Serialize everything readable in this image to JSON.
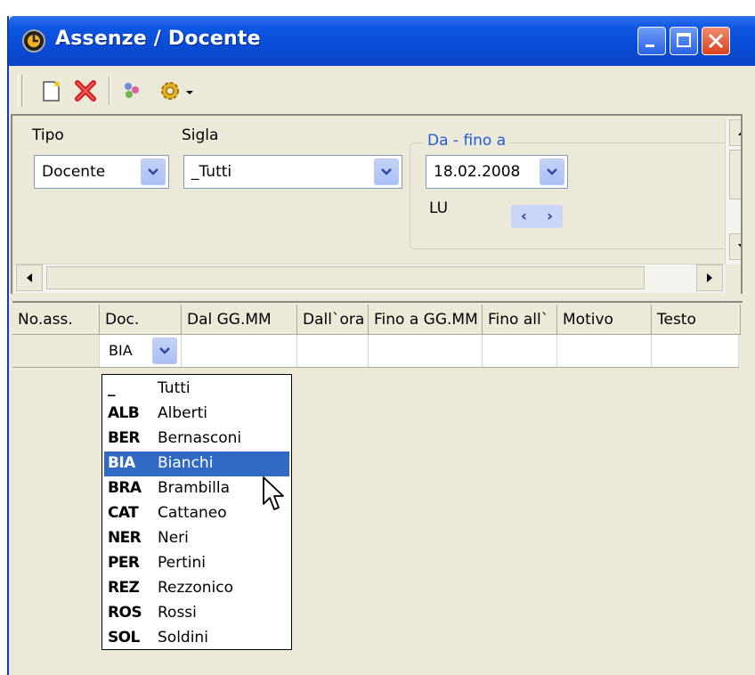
{
  "window": {
    "title": "Assenze / Docente"
  },
  "filters": {
    "tipo_label": "Tipo",
    "tipo_value": "Docente",
    "sigla_label": "Sigla",
    "sigla_value": "_Tutti",
    "group_title": "Da - fino a",
    "date_value": "18.02.2008",
    "day_label": "LU",
    "nav_prev": "‹",
    "nav_next": "›"
  },
  "table": {
    "columns": [
      "No.ass.",
      "Doc.",
      "Dal GG.MM",
      "Dall`ora",
      "Fino a GG.MM",
      "Fino all`",
      "Motivo",
      "Testo"
    ],
    "row_doc_value": "BIA"
  },
  "dropdown": {
    "items": [
      {
        "code": "_",
        "name": "Tutti"
      },
      {
        "code": "ALB",
        "name": "Alberti"
      },
      {
        "code": "BER",
        "name": "Bernasconi"
      },
      {
        "code": "BIA",
        "name": "Bianchi"
      },
      {
        "code": "BRA",
        "name": "Brambilla"
      },
      {
        "code": "CAT",
        "name": "Cattaneo"
      },
      {
        "code": "NER",
        "name": "Neri"
      },
      {
        "code": "PER",
        "name": "Pertini"
      },
      {
        "code": "REZ",
        "name": "Rezzonico"
      },
      {
        "code": "ROS",
        "name": "Rossi"
      },
      {
        "code": "SOL",
        "name": "Soldini"
      }
    ],
    "selected": "BIA"
  },
  "colors": {
    "titlebar": "#0a4cd6",
    "selection": "#316ac5",
    "group_title": "#1f5bdb",
    "window_bg": "#ece9d8"
  }
}
